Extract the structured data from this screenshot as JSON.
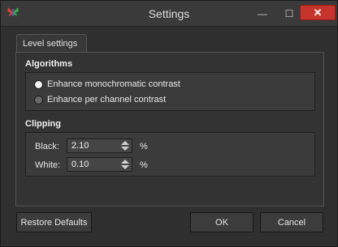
{
  "window": {
    "title": "Settings",
    "icon": "butterfly-app-icon",
    "minimize_glyph": "—",
    "maximize_glyph": "☐",
    "close_glyph": "✕"
  },
  "tab": {
    "label": "Level settings"
  },
  "algorithms": {
    "heading": "Algorithms",
    "options": [
      {
        "label": "Enhance monochromatic contrast",
        "selected": true
      },
      {
        "label": "Enhance per channel contrast",
        "selected": false
      }
    ]
  },
  "clipping": {
    "heading": "Clipping",
    "black": {
      "label": "Black:",
      "value": "2.10",
      "unit": "%"
    },
    "white": {
      "label": "White:",
      "value": "0.10",
      "unit": "%"
    }
  },
  "buttons": {
    "restore": "Restore Defaults",
    "ok": "OK",
    "cancel": "Cancel"
  },
  "colors": {
    "close_button": "#c7342b",
    "background": "#2f2f2f"
  }
}
